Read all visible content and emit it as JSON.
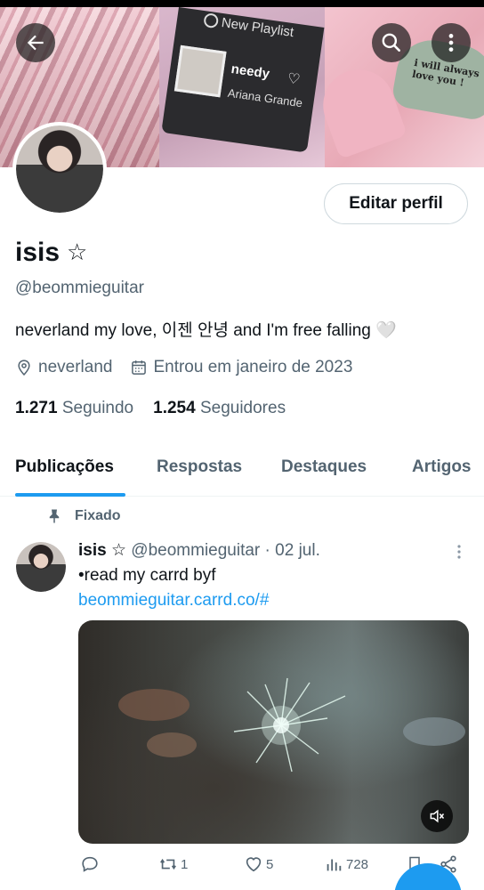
{
  "banner": {
    "playlist_header": "New Playlist",
    "song_title": "needy",
    "song_artist": "Ariana Grande",
    "sign_text": "i will always love you !"
  },
  "profile": {
    "edit_button": "Editar perfil",
    "name": "isis",
    "name_symbol": "☆",
    "handle": "@beommieguitar",
    "bio": "neverland my love, 이젠 안녕 and I'm free falling 🤍",
    "location": "neverland",
    "joined": "Entrou em janeiro de 2023",
    "following_count": "1.271",
    "following_label": "Seguindo",
    "followers_count": "1.254",
    "followers_label": "Seguidores"
  },
  "tabs": [
    {
      "label": "Publicações",
      "active": true
    },
    {
      "label": "Respostas",
      "active": false
    },
    {
      "label": "Destaques",
      "active": false
    },
    {
      "label": "Artigos",
      "active": false
    }
  ],
  "post": {
    "pinned_label": "Fixado",
    "author_name": "isis ☆",
    "author_handle": "@beommieguitar",
    "separator": "·",
    "date": "02 jul.",
    "text": "•read my carrd byf",
    "link": "beommieguitar.carrd.co/#",
    "retweets": "1",
    "likes": "5",
    "views": "728"
  },
  "colors": {
    "accent": "#1d9bf0",
    "text_primary": "#0f1419",
    "text_secondary": "#536471"
  }
}
